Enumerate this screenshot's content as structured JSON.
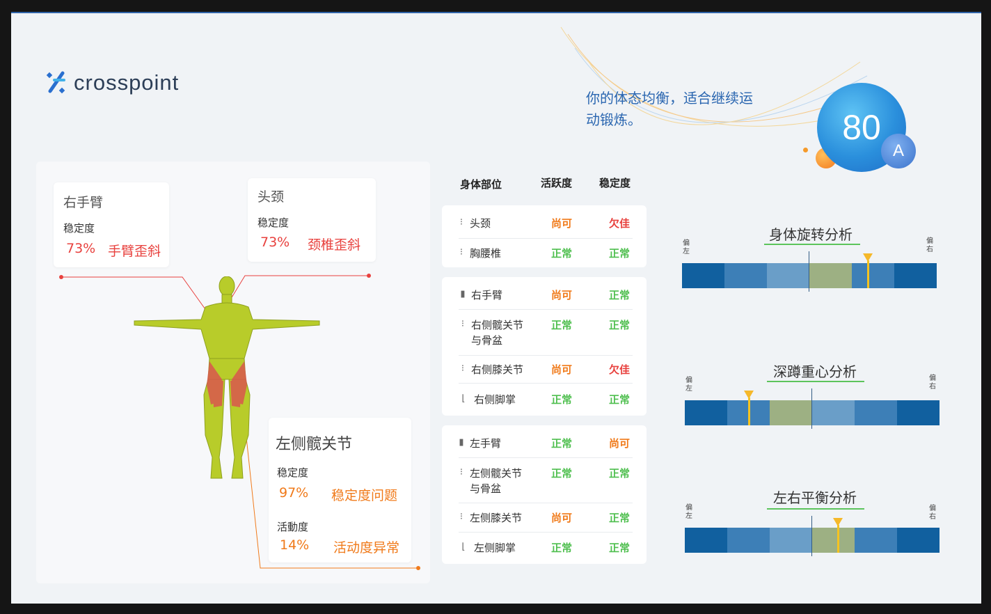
{
  "app": {
    "logo_text": "crosspoint"
  },
  "summary": {
    "text": "你的体态均衡，适合继续运动锻炼。",
    "score": "80",
    "grade": "A"
  },
  "body_cards": {
    "right_arm": {
      "title": "右手臂",
      "metric": "稳定度",
      "percent": "73%",
      "issue": "手臂歪斜"
    },
    "head_neck": {
      "title": "头颈",
      "metric": "稳定度",
      "percent": "73%",
      "issue": "颈椎歪斜"
    },
    "left_hip": {
      "title": "左侧髋关节",
      "metric1": "稳定度",
      "percent1": "97%",
      "issue1": "稳定度问题",
      "metric2": "活動度",
      "percent2": "14%",
      "issue2": "活动度异常"
    }
  },
  "table": {
    "headers": {
      "part": "身体部位",
      "activity": "活跃度",
      "stability": "稳定度"
    },
    "groups": [
      [
        {
          "part": "头颈",
          "activity": "尚可",
          "stability": "欠佳"
        },
        {
          "part": "胸腰椎",
          "activity": "正常",
          "stability": "正常"
        }
      ],
      [
        {
          "part": "右手臂",
          "activity": "尚可",
          "stability": "正常"
        },
        {
          "part_line1": "右侧髋关节",
          "part_line2": "与骨盆",
          "activity": "正常",
          "stability": "正常"
        },
        {
          "part": "右侧膝关节",
          "activity": "尚可",
          "stability": "欠佳"
        },
        {
          "part": "右侧脚掌",
          "activity": "正常",
          "stability": "正常"
        }
      ],
      [
        {
          "part": "左手臂",
          "activity": "正常",
          "stability": "尚可"
        },
        {
          "part_line1": "左侧髋关节",
          "part_line2": "与骨盆",
          "activity": "正常",
          "stability": "正常"
        },
        {
          "part": "左侧膝关节",
          "activity": "尚可",
          "stability": "正常"
        },
        {
          "part": "左侧脚掌",
          "activity": "正常",
          "stability": "正常"
        }
      ]
    ]
  },
  "analysis": {
    "left_label": "偏左",
    "right_label": "偏右",
    "rotation": {
      "title": "身体旋转分析",
      "marker_fraction": 0.73
    },
    "squat": {
      "title": "深蹲重心分析",
      "marker_fraction": 0.25
    },
    "balance": {
      "title": "左右平衡分析",
      "marker_fraction": 0.6
    }
  },
  "colors": {
    "accent": "#2a66b0",
    "normal": "#4fbf4f",
    "fair": "#f07a1a",
    "poor": "#e8413e",
    "bar_dark": "#11609f"
  }
}
